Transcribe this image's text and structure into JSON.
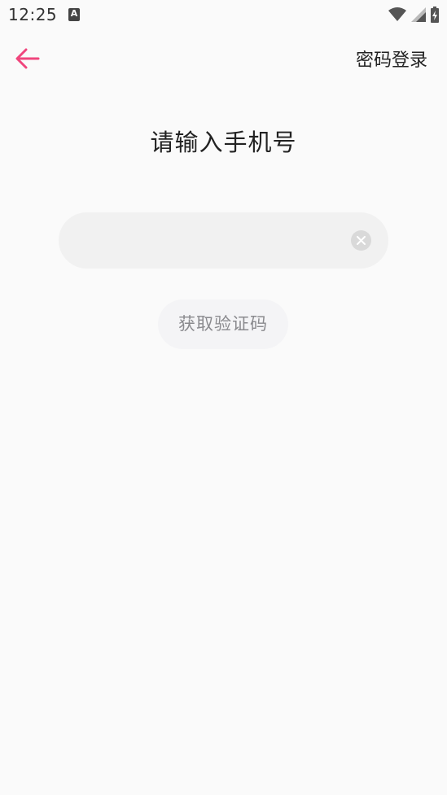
{
  "status_bar": {
    "time": "12:25",
    "a_icon_letter": "A",
    "icons": [
      "wifi-icon",
      "signal-icon",
      "battery-charging-icon"
    ]
  },
  "nav": {
    "back_icon": "arrow-left-icon",
    "password_login_label": "密码登录"
  },
  "main": {
    "title": "请输入手机号",
    "phone_input": {
      "value": "",
      "placeholder": ""
    },
    "clear_icon": "clear-circle-icon",
    "get_code_label": "获取验证码"
  },
  "colors": {
    "accent": "#f0467d",
    "background": "#fafafa",
    "input_bg": "#f1f1f1",
    "button_text": "#8a8a8e"
  }
}
